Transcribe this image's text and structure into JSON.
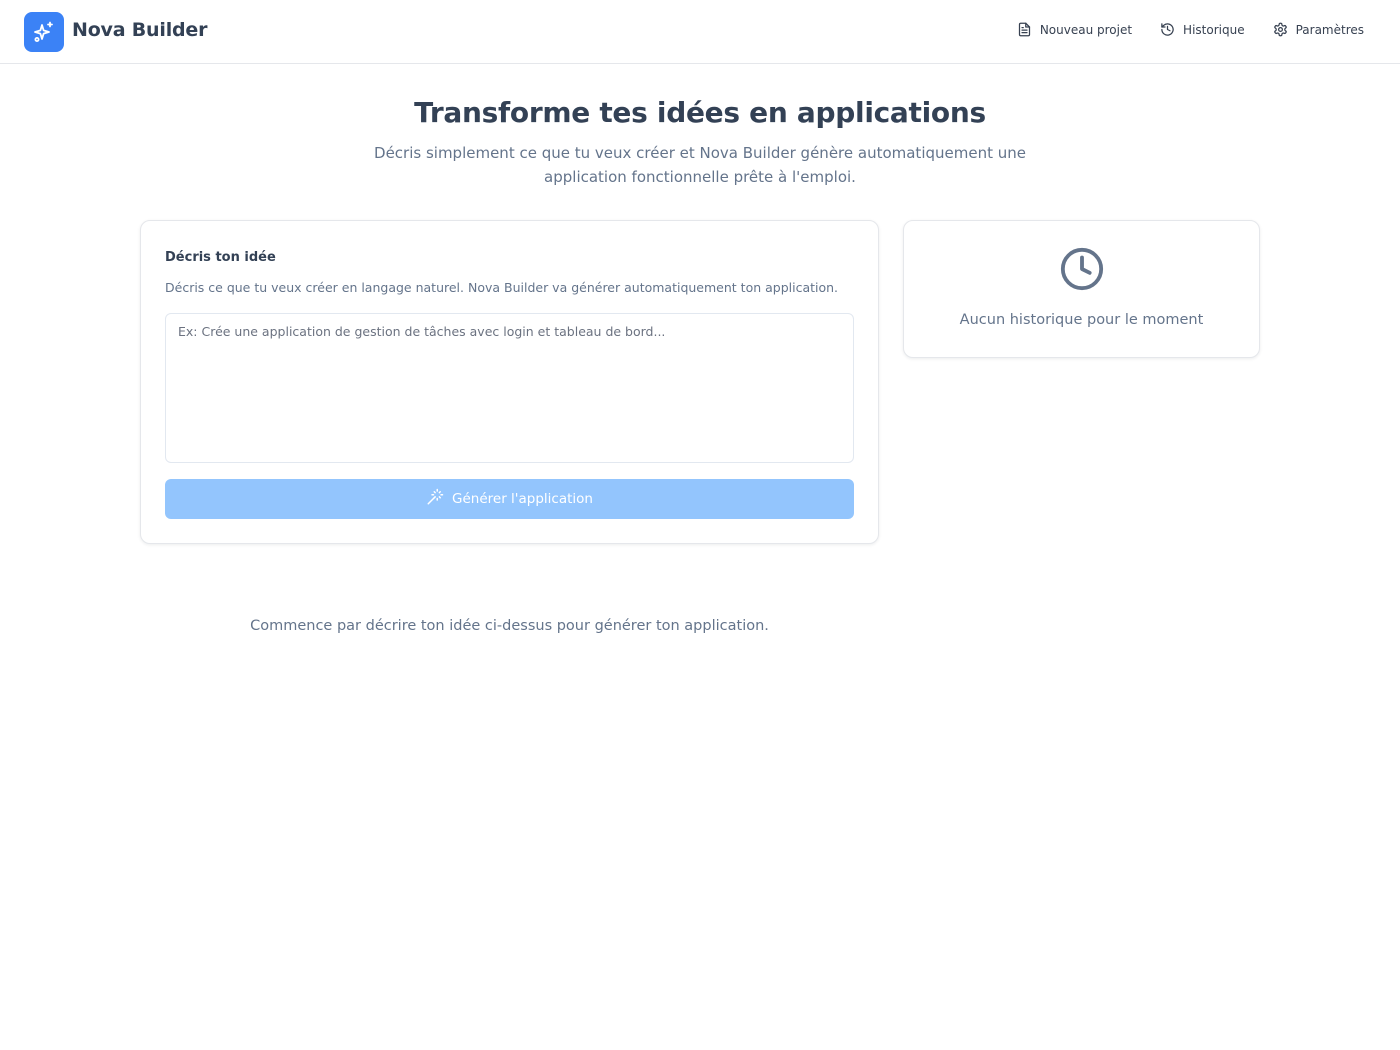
{
  "header": {
    "brand": "Nova Builder",
    "logo_icon": "sparkles-icon",
    "nav": [
      {
        "label": "Nouveau projet",
        "icon": "document-icon"
      },
      {
        "label": "Historique",
        "icon": "history-icon"
      },
      {
        "label": "Paramètres",
        "icon": "gear-icon"
      }
    ]
  },
  "hero": {
    "title": "Transforme tes idées en applications",
    "subtitle_line1": "Décris simplement ce que tu veux créer et Nova Builder génère automatiquement une",
    "subtitle_line2": "application fonctionnelle prête à l'emploi."
  },
  "idea_card": {
    "title": "Décris ton idée",
    "description": "Décris ce que tu veux créer en langage naturel. Nova Builder va générer automatiquement ton application.",
    "input_value": "",
    "input_placeholder": "Ex: Crée une application de gestion de tâches avec login et tableau de bord...",
    "button_label": "Générer l'application",
    "button_icon": "magic-wand-icon",
    "button_state": "disabled"
  },
  "history_card": {
    "icon": "clock-icon",
    "empty_text": "Aucun historique pour le moment"
  },
  "hint_text": "Commence par décrire ton idée ci-dessus pour générer ton application.",
  "colors": {
    "accent": "#3b82f6",
    "button_disabled": "#93c5fd",
    "text_primary": "#334155",
    "text_muted": "#64748b",
    "border": "#e5e7eb"
  }
}
